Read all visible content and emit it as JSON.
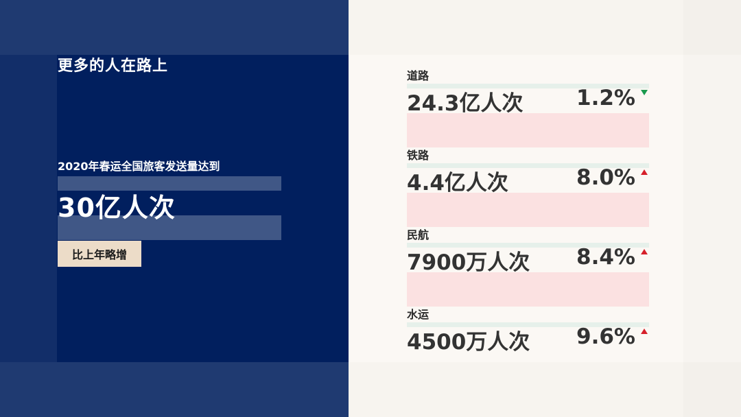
{
  "left": {
    "headline": "更多的人在路上",
    "subline": "2020年春运全国旅客发送量达到",
    "big_number": "30亿人次",
    "badge": "比上年略增"
  },
  "stats": [
    {
      "label": "道路",
      "value": "24.3亿人次",
      "change": "1.2%",
      "direction": "down",
      "color": "#1a9a4e"
    },
    {
      "label": "铁路",
      "value": "4.4亿人次",
      "change": "8.0%",
      "direction": "up",
      "color": "#d6202a"
    },
    {
      "label": "民航",
      "value": "7900万人次",
      "change": "8.4%",
      "direction": "up",
      "color": "#d6202a"
    },
    {
      "label": "水运",
      "value": "4500万人次",
      "change": "9.6%",
      "direction": "up",
      "color": "#d6202a"
    }
  ],
  "colors": {
    "panel": "#011f5e",
    "badge": "#ecdcc8",
    "increase": "#d6202a",
    "decrease": "#1a9a4e"
  }
}
